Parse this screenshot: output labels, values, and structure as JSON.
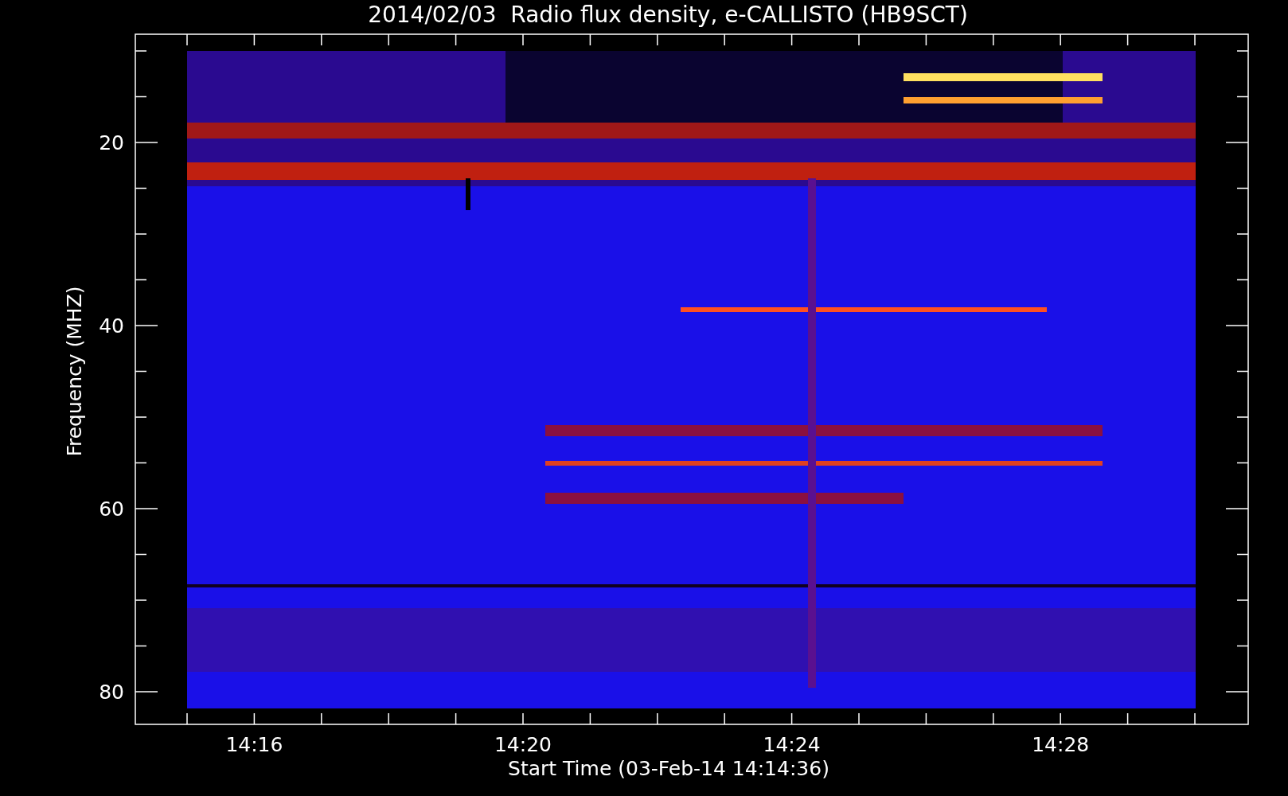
{
  "title": "2014/02/03  Radio flux density, e-CALLISTO (HB9SCT)",
  "y_axis": {
    "label": "Frequency (MHZ)",
    "ticks": [
      "20",
      "40",
      "60",
      "80"
    ]
  },
  "x_axis": {
    "label": "Start Time (03-Feb-14 14:14:36)",
    "ticks": [
      "14:16",
      "14:20",
      "14:24",
      "14:28"
    ]
  }
}
